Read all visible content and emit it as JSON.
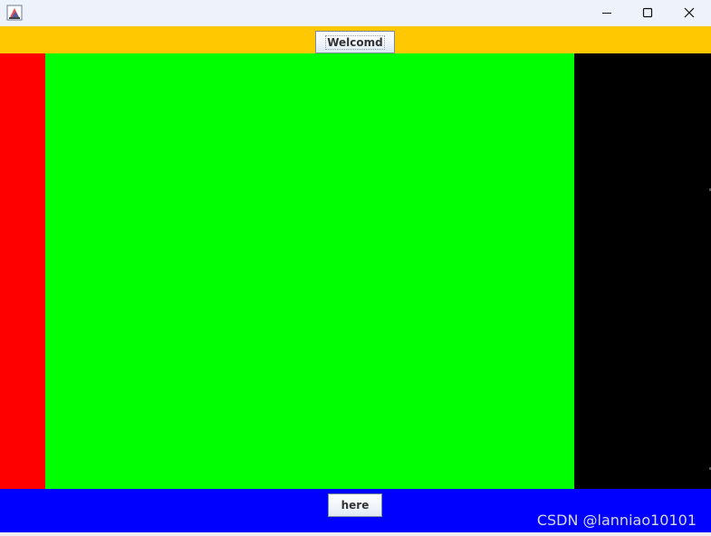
{
  "window": {
    "title": "",
    "controls": {
      "minimize": "minimize-icon",
      "maximize": "maximize-icon",
      "close": "close-icon"
    }
  },
  "layout_regions": {
    "north": {
      "color": "#ffc800",
      "button_label": "Welcomd"
    },
    "west": {
      "color": "#ff0000"
    },
    "center": {
      "color": "#00ff00"
    },
    "east": {
      "color": "#000000"
    },
    "south": {
      "color": "#0000ff",
      "button_label": "here"
    }
  },
  "watermark": "CSDN @lanniao10101"
}
